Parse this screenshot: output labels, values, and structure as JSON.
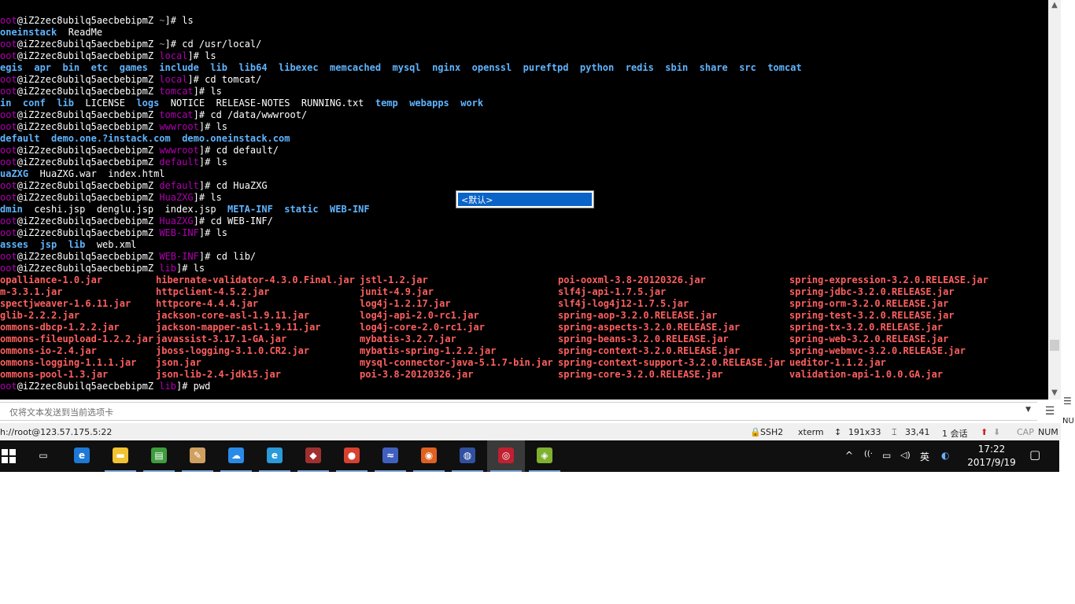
{
  "terminal": {
    "lines": [
      [
        {
          "t": "oot",
          "c": "t-rt"
        },
        {
          "t": "@iZ2zec8ubilq5aecbebipmZ ",
          "c": "t-pr"
        },
        {
          "t": "~",
          "c": "t-dim"
        },
        {
          "t": "]# ls",
          "c": "t-pr"
        }
      ],
      [
        {
          "t": "oneinstack",
          "c": "t-dir"
        },
        {
          "t": "  ReadMe",
          "c": "t-file"
        }
      ],
      [
        {
          "t": "oot",
          "c": "t-rt"
        },
        {
          "t": "@iZ2zec8ubilq5aecbebipmZ ",
          "c": "t-pr"
        },
        {
          "t": "~",
          "c": "t-dim"
        },
        {
          "t": "]# cd /usr/local/",
          "c": "t-pr"
        }
      ],
      [
        {
          "t": "oot",
          "c": "t-rt"
        },
        {
          "t": "@iZ2zec8ubilq5aecbebipmZ ",
          "c": "t-pr"
        },
        {
          "t": "local",
          "c": "t-rt"
        },
        {
          "t": "]# ls",
          "c": "t-pr"
        }
      ],
      [
        {
          "t": "egis  apr  bin  etc  games  include  lib  lib64  libexec  memcached  mysql  nginx  openssl  pureftpd  python  redis  sbin  share  src  tomcat",
          "c": "t-dir"
        }
      ],
      [
        {
          "t": "oot",
          "c": "t-rt"
        },
        {
          "t": "@iZ2zec8ubilq5aecbebipmZ ",
          "c": "t-pr"
        },
        {
          "t": "local",
          "c": "t-rt"
        },
        {
          "t": "]# cd tomcat/",
          "c": "t-pr"
        }
      ],
      [
        {
          "t": "oot",
          "c": "t-rt"
        },
        {
          "t": "@iZ2zec8ubilq5aecbebipmZ ",
          "c": "t-pr"
        },
        {
          "t": "tomcat",
          "c": "t-rt"
        },
        {
          "t": "]# ls",
          "c": "t-pr"
        }
      ],
      [
        {
          "t": "in  conf  lib  ",
          "c": "t-dir"
        },
        {
          "t": "LICENSE  ",
          "c": "t-file"
        },
        {
          "t": "logs  ",
          "c": "t-dir"
        },
        {
          "t": "NOTICE  RELEASE-NOTES  RUNNING.txt  ",
          "c": "t-file"
        },
        {
          "t": "temp  webapps  work",
          "c": "t-dir"
        }
      ],
      [
        {
          "t": "oot",
          "c": "t-rt"
        },
        {
          "t": "@iZ2zec8ubilq5aecbebipmZ ",
          "c": "t-pr"
        },
        {
          "t": "tomcat",
          "c": "t-rt"
        },
        {
          "t": "]# cd /data/wwwroot/",
          "c": "t-pr"
        }
      ],
      [
        {
          "t": "oot",
          "c": "t-rt"
        },
        {
          "t": "@iZ2zec8ubilq5aecbebipmZ ",
          "c": "t-pr"
        },
        {
          "t": "wwwroot",
          "c": "t-rt"
        },
        {
          "t": "]# ls",
          "c": "t-pr"
        }
      ],
      [
        {
          "t": "default  demo.one.?instack.com  demo.oneinstack.com",
          "c": "t-dir"
        }
      ],
      [
        {
          "t": "oot",
          "c": "t-rt"
        },
        {
          "t": "@iZ2zec8ubilq5aecbebipmZ ",
          "c": "t-pr"
        },
        {
          "t": "wwwroot",
          "c": "t-rt"
        },
        {
          "t": "]# cd default/",
          "c": "t-pr"
        }
      ],
      [
        {
          "t": "oot",
          "c": "t-rt"
        },
        {
          "t": "@iZ2zec8ubilq5aecbebipmZ ",
          "c": "t-pr"
        },
        {
          "t": "default",
          "c": "t-rt"
        },
        {
          "t": "]# ls",
          "c": "t-pr"
        }
      ],
      [
        {
          "t": "uaZXG",
          "c": "t-dir"
        },
        {
          "t": "  HuaZXG.war  index.html",
          "c": "t-file"
        }
      ],
      [
        {
          "t": "oot",
          "c": "t-rt"
        },
        {
          "t": "@iZ2zec8ubilq5aecbebipmZ ",
          "c": "t-pr"
        },
        {
          "t": "default",
          "c": "t-rt"
        },
        {
          "t": "]# cd HuaZXG",
          "c": "t-pr"
        }
      ],
      [
        {
          "t": "oot",
          "c": "t-rt"
        },
        {
          "t": "@iZ2zec8ubilq5aecbebipmZ ",
          "c": "t-pr"
        },
        {
          "t": "HuaZXG",
          "c": "t-rt"
        },
        {
          "t": "]# ls",
          "c": "t-pr"
        }
      ],
      [
        {
          "t": "dmin",
          "c": "t-dir"
        },
        {
          "t": "  ceshi.jsp  denglu.jsp  index.jsp  ",
          "c": "t-file"
        },
        {
          "t": "META-INF  static  WEB-INF",
          "c": "t-dir"
        }
      ],
      [
        {
          "t": "oot",
          "c": "t-rt"
        },
        {
          "t": "@iZ2zec8ubilq5aecbebipmZ ",
          "c": "t-pr"
        },
        {
          "t": "HuaZXG",
          "c": "t-rt"
        },
        {
          "t": "]# cd WEB-INF/",
          "c": "t-pr"
        }
      ],
      [
        {
          "t": "oot",
          "c": "t-rt"
        },
        {
          "t": "@iZ2zec8ubilq5aecbebipmZ ",
          "c": "t-pr"
        },
        {
          "t": "WEB-INF",
          "c": "t-rt"
        },
        {
          "t": "]# ls",
          "c": "t-pr"
        }
      ],
      [
        {
          "t": "asses  jsp  lib",
          "c": "t-dir"
        },
        {
          "t": "  web.xml",
          "c": "t-file"
        }
      ],
      [
        {
          "t": "oot",
          "c": "t-rt"
        },
        {
          "t": "@iZ2zec8ubilq5aecbebipmZ ",
          "c": "t-pr"
        },
        {
          "t": "WEB-INF",
          "c": "t-rt"
        },
        {
          "t": "]# cd lib/",
          "c": "t-pr"
        }
      ],
      [
        {
          "t": "oot",
          "c": "t-rt"
        },
        {
          "t": "@iZ2zec8ubilq5aecbebipmZ ",
          "c": "t-pr"
        },
        {
          "t": "lib",
          "c": "t-rt"
        },
        {
          "t": "]# ls",
          "c": "t-pr"
        }
      ]
    ],
    "jar_columns": [
      [
        "opalliance-1.0.jar",
        "m-3.3.1.jar",
        "spectjweaver-1.6.11.jar",
        "glib-2.2.2.jar",
        "ommons-dbcp-1.2.2.jar",
        "ommons-fileupload-1.2.2.jar",
        "ommons-io-2.4.jar",
        "ommons-logging-1.1.1.jar",
        "ommons-pool-1.3.jar"
      ],
      [
        "hibernate-validator-4.3.0.Final.jar",
        "httpclient-4.5.2.jar",
        "httpcore-4.4.4.jar",
        "jackson-core-asl-1.9.11.jar",
        "jackson-mapper-asl-1.9.11.jar",
        "javassist-3.17.1-GA.jar",
        "jboss-logging-3.1.0.CR2.jar",
        "json.jar",
        "json-lib-2.4-jdk15.jar"
      ],
      [
        "jstl-1.2.jar",
        "junit-4.9.jar",
        "log4j-1.2.17.jar",
        "log4j-api-2.0-rc1.jar",
        "log4j-core-2.0-rc1.jar",
        "mybatis-3.2.7.jar",
        "mybatis-spring-1.2.2.jar",
        "mysql-connector-java-5.1.7-bin.jar",
        "poi-3.8-20120326.jar"
      ],
      [
        "poi-ooxml-3.8-20120326.jar",
        "slf4j-api-1.7.5.jar",
        "slf4j-log4j12-1.7.5.jar",
        "spring-aop-3.2.0.RELEASE.jar",
        "spring-aspects-3.2.0.RELEASE.jar",
        "spring-beans-3.2.0.RELEASE.jar",
        "spring-context-3.2.0.RELEASE.jar",
        "spring-context-support-3.2.0.RELEASE.jar",
        "spring-core-3.2.0.RELEASE.jar"
      ],
      [
        "spring-expression-3.2.0.RELEASE.jar",
        "spring-jdbc-3.2.0.RELEASE.jar",
        "spring-orm-3.2.0.RELEASE.jar",
        "spring-test-3.2.0.RELEASE.jar",
        "spring-tx-3.2.0.RELEASE.jar",
        "spring-web-3.2.0.RELEASE.jar",
        "spring-webmvc-3.2.0.RELEASE.jar",
        "ueditor-1.1.2.jar",
        "validation-api-1.0.0.GA.jar"
      ]
    ],
    "last_line": [
      {
        "t": "oot",
        "c": "t-rt"
      },
      {
        "t": "@iZ2zec8ubilq5aecbebipmZ ",
        "c": "t-pr"
      },
      {
        "t": "lib",
        "c": "t-rt"
      },
      {
        "t": "]# pwd",
        "c": "t-pr"
      }
    ]
  },
  "ime_popup": {
    "label": "<默认>"
  },
  "send_bar": {
    "placeholder": "仅将文本发送到当前选项卡",
    "dropdown_icon": "▼",
    "menu_icon": "☰"
  },
  "status_bar": {
    "connection": "h://root@123.57.175.5:22",
    "protocol": "SSH2",
    "term_type": "xterm",
    "size": "191x33",
    "cursor": "33,41",
    "sessions": "1 会话",
    "cap": "CAP",
    "num": "NUM"
  },
  "right_strip": {
    "num_fragment": "NU"
  },
  "taskbar": {
    "apps": [
      {
        "name": "task-view-icon",
        "glyph": "▭",
        "bg": "transparent"
      },
      {
        "name": "edge-icon",
        "glyph": "e",
        "bg": "#1e78d6"
      },
      {
        "name": "file-explorer-icon",
        "glyph": "▬",
        "bg": "#f2c230"
      },
      {
        "name": "spreadsheet-icon",
        "glyph": "▤",
        "bg": "#3e9c3e"
      },
      {
        "name": "paint-icon",
        "glyph": "✎",
        "bg": "#d0a060"
      },
      {
        "name": "baidu-netdisk-icon",
        "glyph": "☁",
        "bg": "#2a8ae8"
      },
      {
        "name": "ie-icon",
        "glyph": "e",
        "bg": "#2a9ad8"
      },
      {
        "name": "java-ee-icon",
        "glyph": "◆",
        "bg": "#a03030"
      },
      {
        "name": "chrome-icon",
        "glyph": "●",
        "bg": "#d84030"
      },
      {
        "name": "dolphin-icon",
        "glyph": "≈",
        "bg": "#4060c0"
      },
      {
        "name": "firefox-icon",
        "glyph": "◉",
        "bg": "#e06020"
      },
      {
        "name": "globe-icon",
        "glyph": "◍",
        "bg": "#3050a0"
      },
      {
        "name": "xshell-icon",
        "glyph": "◎",
        "bg": "#c02030"
      },
      {
        "name": "xftp-icon",
        "glyph": "◈",
        "bg": "#80b030"
      }
    ],
    "tray": {
      "chevron": "^",
      "wifi": "((·",
      "battery": "▭",
      "volume": "◁)",
      "ime": "英",
      "security": "◐"
    },
    "clock_time": "17:22",
    "clock_date": "2017/9/19",
    "notification": "▢"
  }
}
